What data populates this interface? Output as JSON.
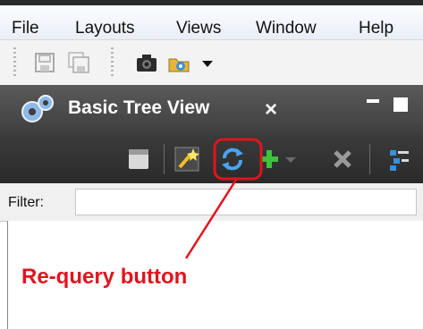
{
  "menubar": {
    "items": [
      "File",
      "Layouts",
      "Views",
      "Window",
      "Help"
    ]
  },
  "toolbar": {
    "buttons": [
      "save-icon",
      "save-all-icon",
      "camera-icon",
      "open-project-icon",
      "chevron-down-icon"
    ]
  },
  "view": {
    "title": "Basic Tree View",
    "close_glyph": "×",
    "icon": "gear-icon"
  },
  "view_toolbar": {
    "buttons": [
      "panel-icon",
      "wand-icon",
      "refresh-icon",
      "add-icon",
      "dropdown-icon",
      "delete-icon",
      "tree-list-icon"
    ]
  },
  "filter": {
    "label": "Filter:",
    "value": ""
  },
  "annotation": {
    "label": "Re-query button",
    "color": "#e0141e"
  },
  "colors": {
    "view_header": "#4a4a4a",
    "view_toolbar": "#333333",
    "refresh_blue": "#3a8fd8",
    "add_green": "#3cc23c"
  }
}
